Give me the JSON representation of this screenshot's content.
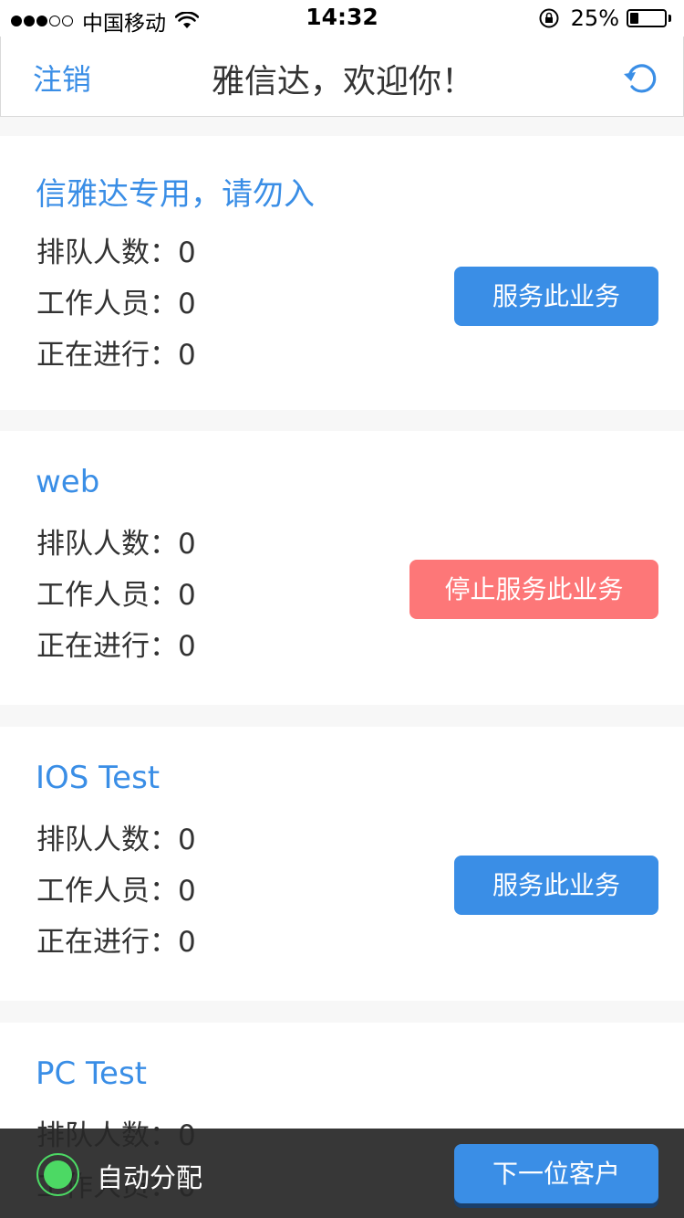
{
  "status_bar": {
    "carrier": "中国移动",
    "time": "14:32",
    "battery": "25%",
    "battery_level": 0.25,
    "signal_bars_filled": 3,
    "signal_bars_total": 5
  },
  "header": {
    "logout_label": "注销",
    "title": "雅信达，欢迎你！",
    "refresh_icon": "refresh-icon"
  },
  "stat_labels": {
    "queue": "排队人数",
    "staff": "工作人员",
    "in_progress": "正在进行",
    "separator": "："
  },
  "services": [
    {
      "name": "信雅达专用，请勿入",
      "queue": "0",
      "staff": "0",
      "in_progress": "0",
      "button": "服务此业务",
      "button_state": "serve"
    },
    {
      "name": "web",
      "queue": "0",
      "staff": "0",
      "in_progress": "0",
      "button": "停止服务此业务",
      "button_state": "stop"
    },
    {
      "name": "IOS Test",
      "queue": "0",
      "staff": "0",
      "in_progress": "0",
      "button": "服务此业务",
      "button_state": "serve"
    },
    {
      "name": "PC Test",
      "queue": "0",
      "staff": "0",
      "in_progress": "",
      "button": "",
      "button_state": "hidden"
    }
  ],
  "bottom_bar": {
    "auto_assign_label": "自动分配",
    "auto_assign_on": true,
    "next_button": "下一位客户"
  },
  "colors": {
    "accent": "#3a8ee6",
    "stop": "#fd7778",
    "toggle_on": "#4cd964"
  }
}
